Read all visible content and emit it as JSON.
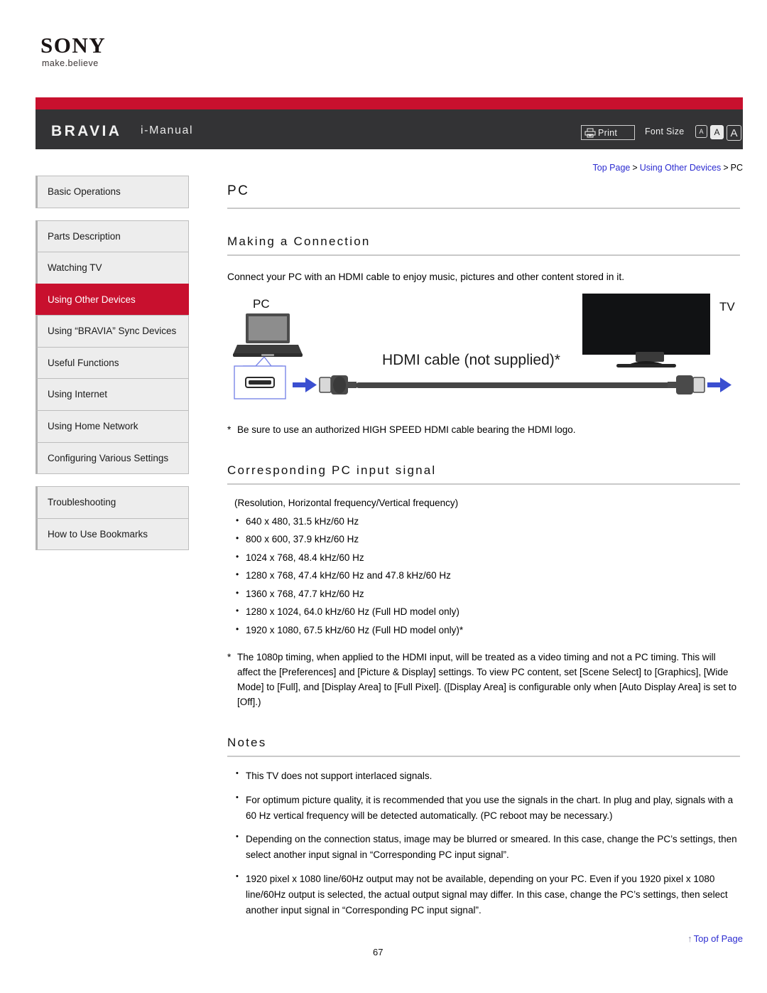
{
  "brand": {
    "logo_text": "SONY",
    "tagline": "make.believe"
  },
  "header": {
    "product": "BRAVIA",
    "manual_label": "i-Manual",
    "print_label": "Print",
    "print_icon": "printer-icon",
    "font_size_label": "Font Size",
    "font_size_options": [
      "A",
      "A",
      "A"
    ],
    "font_size_selected_index": 1,
    "accent_red": "#c8102e",
    "bar_dark": "#333335"
  },
  "breadcrumb": {
    "items": [
      "Top Page",
      "Using Other Devices",
      "PC"
    ],
    "separator": ">",
    "link_color": "#2b2bd0"
  },
  "sidebar": {
    "groups": [
      {
        "items": [
          {
            "label": "Basic Operations",
            "active": false
          }
        ]
      },
      {
        "items": [
          {
            "label": "Parts Description",
            "active": false
          },
          {
            "label": "Watching TV",
            "active": false
          },
          {
            "label": "Using Other Devices",
            "active": true
          },
          {
            "label": "Using “BRAVIA” Sync Devices",
            "active": false
          },
          {
            "label": "Useful Functions",
            "active": false
          },
          {
            "label": "Using Internet",
            "active": false
          },
          {
            "label": "Using Home Network",
            "active": false
          },
          {
            "label": "Configuring Various Settings",
            "active": false
          }
        ]
      },
      {
        "items": [
          {
            "label": "Troubleshooting",
            "active": false
          },
          {
            "label": "How to Use Bookmarks",
            "active": false
          }
        ]
      }
    ]
  },
  "main": {
    "page_title": "PC",
    "section_connection": {
      "heading": "Making a Connection",
      "intro": "Connect your PC with an HDMI cable to enjoy music, pictures and other content stored in it.",
      "diagram": {
        "pc_label": "PC",
        "tv_label": "TV",
        "cable_label": "HDMI cable (not supplied)*"
      },
      "footnote_mark": "*",
      "footnote": "Be sure to use an authorized HIGH SPEED HDMI cable bearing the HDMI logo."
    },
    "section_signal": {
      "heading": "Corresponding PC input signal",
      "format_note": "(Resolution, Horizontal frequency/Vertical frequency)",
      "signals": [
        "640 x 480, 31.5 kHz/60 Hz",
        "800 x 600, 37.9 kHz/60 Hz",
        "1024 x 768, 48.4 kHz/60 Hz",
        "1280 x 768, 47.4 kHz/60 Hz and 47.8 kHz/60 Hz",
        "1360 x 768, 47.7 kHz/60 Hz",
        "1280 x 1024, 64.0 kHz/60 Hz (Full HD model only)",
        "1920 x 1080, 67.5 kHz/60 Hz (Full HD model only)*"
      ],
      "timing_footnote_mark": "*",
      "timing_footnote": "The 1080p timing, when applied to the HDMI input, will be treated as a video timing and not a PC timing. This will affect the [Preferences] and [Picture & Display] settings. To view PC content, set [Scene Select] to [Graphics], [Wide Mode] to [Full], and [Display Area] to [Full Pixel]. ([Display Area] is configurable only when [Auto Display Area] is set to [Off].)"
    },
    "section_notes": {
      "heading": "Notes",
      "notes": [
        "This TV does not support interlaced signals.",
        "For optimum picture quality, it is recommended that you use the signals in the chart. In plug and play, signals with a 60 Hz vertical frequency will be detected automatically. (PC reboot may be necessary.)",
        "Depending on the connection status, image may be blurred or smeared. In this case, change the PC’s settings, then select another input signal in “Corresponding PC input signal”.",
        "1920 pixel x 1080 line/60Hz output may not be available, depending on your PC. Even if you 1920 pixel x 1080 line/60Hz output is selected, the actual output signal may differ. In this case, change the PC’s settings, then select another input signal in “Corresponding PC input signal”."
      ]
    }
  },
  "footer": {
    "page_number": "67",
    "top_of_page_label": "Top of Page",
    "top_of_page_arrow": "↑"
  }
}
